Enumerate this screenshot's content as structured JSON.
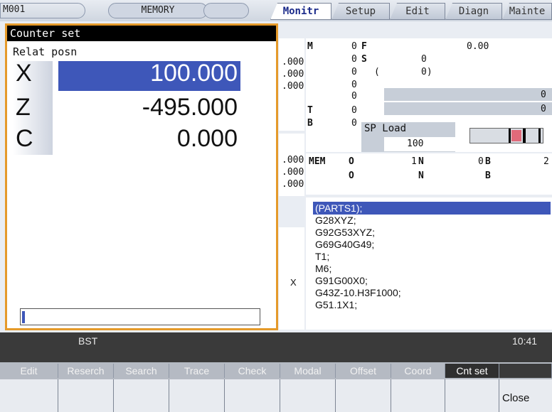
{
  "topbar": {
    "mode_code": "M001",
    "mode_name": "MEMORY",
    "tabs": [
      "Monitr",
      "Setup",
      "Edit",
      "Diagn",
      "Mainte"
    ]
  },
  "dialog": {
    "title": "Counter set",
    "subtitle": "Relat posn",
    "axes": [
      {
        "label": "X",
        "value": "100.000"
      },
      {
        "label": "Z",
        "value": "-495.000"
      },
      {
        "label": "C",
        "value": "0.000"
      }
    ]
  },
  "monitor": {
    "partial_values": [
      ".000",
      ".000",
      ".000",
      ".000",
      ".000",
      ".000"
    ],
    "m_label": "M",
    "m_value": "0",
    "f_label": "F",
    "f_value": "0.00",
    "r2_value": "0",
    "s_label": "S",
    "s_value": "0",
    "r3_value": "0",
    "paren_open": "(",
    "paren_value": "0)",
    "r4_value": "0",
    "r4_right": "0",
    "t_label": "T",
    "t_value": "0",
    "r5_right": "0",
    "b_label": "B",
    "b_value": "0",
    "sp_load_label": "SP Load",
    "sp_load_value": "100",
    "mem_label": "MEM",
    "o1_label": "O",
    "o1_value": "1",
    "n1_label": "N",
    "n1_value": "0",
    "b1_label": "B",
    "b1_value": "2",
    "o2_label": "O",
    "n2_label": "N",
    "b2_label": "B",
    "x_label": "X"
  },
  "program": [
    "(PARTS1);",
    "G28XYZ;",
    "G92G53XYZ;",
    "G69G40G49;",
    "T1;",
    "M6;",
    "G91G00X0;",
    "G43Z-10.H3F1000;",
    "G51.1X1;"
  ],
  "status": {
    "left": "BST",
    "time": "10:41"
  },
  "softkeys": [
    "Edit",
    "Reserch",
    "Search",
    "Trace",
    "Check",
    "Modal",
    "Offset",
    "Coord",
    "Cnt set",
    "",
    "Close"
  ]
}
